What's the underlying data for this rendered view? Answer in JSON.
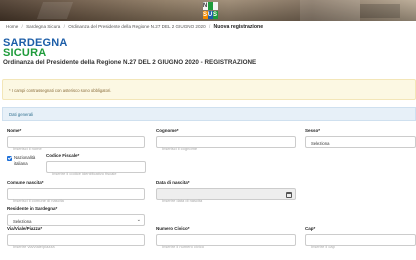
{
  "banner": {
    "logo_letters": [
      "N",
      "S",
      "U",
      "S"
    ]
  },
  "breadcrumb": {
    "home": "Home",
    "items": [
      "Sardegna Sicura",
      "Ordinanza del Presidente della Regione N.27 DEL 2 GIUGNO 2020"
    ],
    "current": "Nuova registrazione"
  },
  "brand": {
    "line1": "SARDEGNA",
    "line2": "SICURA"
  },
  "page_title": "Ordinanza del Presidente della Regione N.27 DEL 2 GIUGNO 2020 - REGISTRAZIONE",
  "notice": "* I campi contrassegnati con asterisco sono obbligatori.",
  "section": {
    "title": "Dati generali"
  },
  "form": {
    "nome": {
      "label": "Nome*",
      "placeholder": "Inserisci il nome"
    },
    "cognome": {
      "label": "Cognome*",
      "placeholder": "Inserisci il cognome"
    },
    "sesso": {
      "label": "Sesso*",
      "value": "Seleziona"
    },
    "nazionalita": {
      "label_line1": "Nazionalità",
      "label_line2": "italiana",
      "checked": true
    },
    "codice_fiscale": {
      "label": "Codice Fiscale*",
      "placeholder": "Inserire il codice identificativo fiscale"
    },
    "comune_nascita": {
      "label": "Comune nascita*",
      "placeholder": "Inserisci il comune di nascita"
    },
    "data_nascita": {
      "label": "Data di nascita*",
      "placeholder": "Inserire data di nascita"
    },
    "residente": {
      "label": "Residente in Sardegna*",
      "value": "Seleziona"
    },
    "via": {
      "label": "Via/Viale/Piazza*",
      "placeholder": "Inserire via/viale/piazza"
    },
    "civico": {
      "label": "Numero Civico*",
      "placeholder": "Inserire il numero civico"
    },
    "cap": {
      "label": "Cap*",
      "placeholder": "Inserire il cap"
    }
  }
}
